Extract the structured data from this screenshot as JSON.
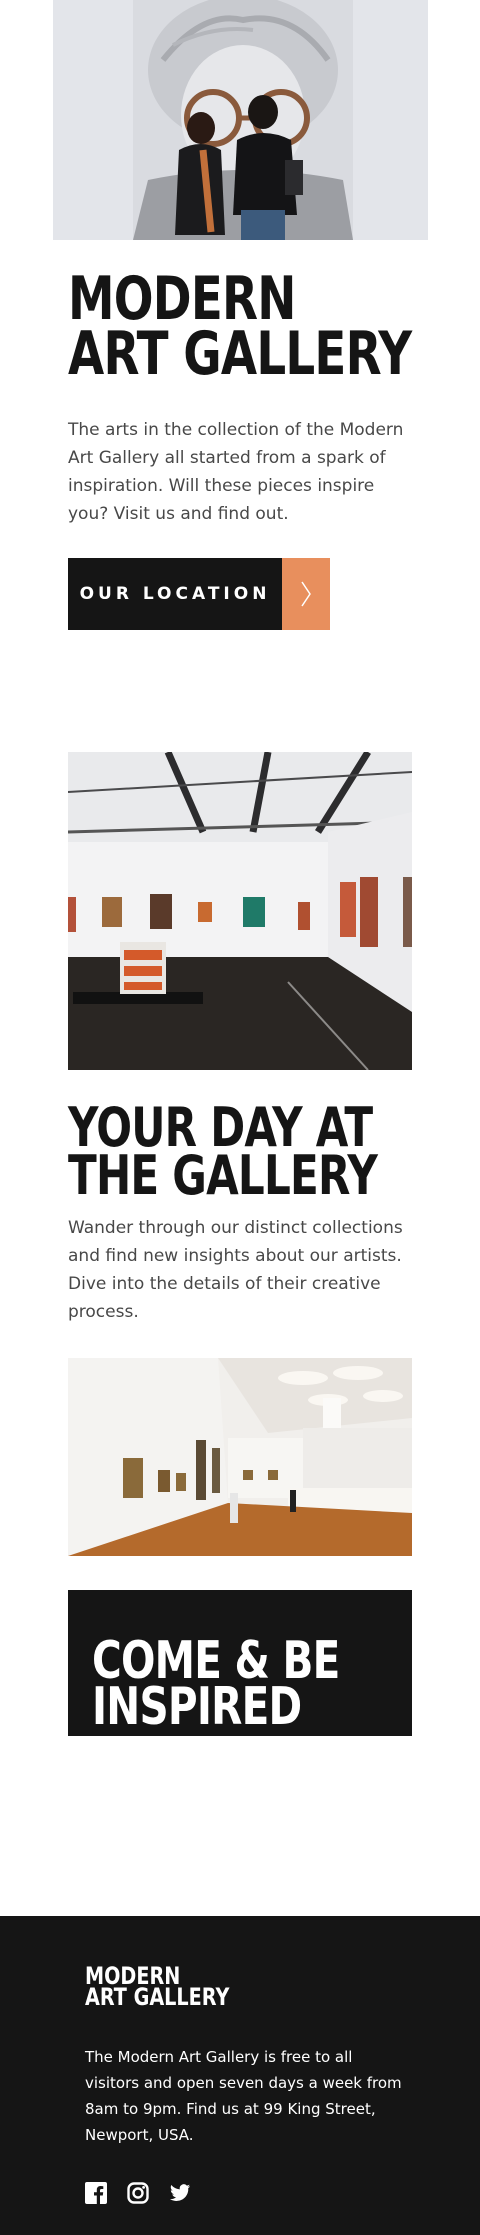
{
  "hero": {
    "title_line1": "Modern",
    "title_line2": "Art Gallery",
    "text": "The arts in the collection of the Modern Art Gallery all started from a spark of inspiration. Will these pieces inspire you? Visit us and find out.",
    "button_label": "OUR LOCATION",
    "button_icon": "chevron-right-icon"
  },
  "day_section": {
    "title_line1": "Your Day at",
    "title_line2": "the Gallery",
    "text": "Wander through our distinct collections and find new insights about our artists. Dive into the details of their creative process."
  },
  "inspired": {
    "title_line1": "Come & Be",
    "title_line2": "Inspired"
  },
  "footer": {
    "logo_line1": "Modern",
    "logo_line2": "Art Gallery",
    "text": "The Modern Art Gallery is free to all visitors and open seven days a week from 8am to 9pm. Find us at 99 King Street, Newport, USA.",
    "social_icons": [
      "facebook-icon",
      "instagram-icon",
      "twitter-icon"
    ]
  },
  "colors": {
    "accent": "#e88f5d",
    "dark": "#151515",
    "text_gray": "#484848",
    "white": "#ffffff"
  }
}
